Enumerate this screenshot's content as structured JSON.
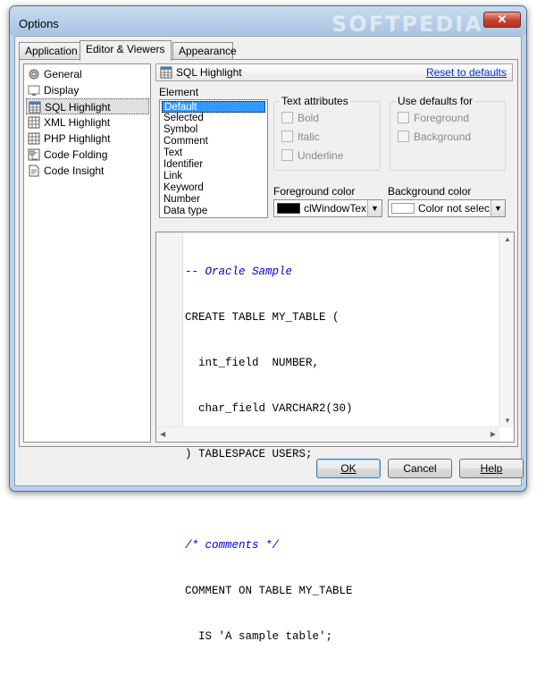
{
  "window": {
    "title": "Options",
    "watermark": "SOFTPEDIA",
    "close_glyph": "✕"
  },
  "tabs": [
    {
      "label": "Application",
      "active": false
    },
    {
      "label": "Editor & Viewers",
      "active": true
    },
    {
      "label": "Appearance",
      "active": false
    }
  ],
  "tree": {
    "items": [
      {
        "label": "General",
        "icon": "gear-icon"
      },
      {
        "label": "Display",
        "icon": "display-icon"
      },
      {
        "label": "SQL Highlight",
        "icon": "grid-icon",
        "selected": true
      },
      {
        "label": "XML Highlight",
        "icon": "grid-icon"
      },
      {
        "label": "PHP Highlight",
        "icon": "grid-icon"
      },
      {
        "label": "Code Folding",
        "icon": "folding-icon"
      },
      {
        "label": "Code Insight",
        "icon": "insight-icon"
      }
    ]
  },
  "panel": {
    "title": "SQL Highlight",
    "reset_label": "Reset to defaults",
    "element_label": "Element",
    "elements": [
      "Default",
      "Selected",
      "Symbol",
      "Comment",
      "Text",
      "Identifier",
      "Link",
      "Keyword",
      "Number",
      "Data type"
    ],
    "selected_element": "Default",
    "text_attributes": {
      "title": "Text attributes",
      "bold": "Bold",
      "italic": "Italic",
      "underline": "Underline"
    },
    "use_defaults": {
      "title": "Use defaults for",
      "foreground": "Foreground",
      "background": "Background"
    },
    "foreground": {
      "label": "Foreground color",
      "value": "clWindowText",
      "swatch": "#000000"
    },
    "background": {
      "label": "Background color",
      "value": "Color not selected",
      "swatch": "#ffffff"
    }
  },
  "code_lines": [
    {
      "text": "-- Oracle Sample",
      "comment": true
    },
    {
      "text": "CREATE TABLE MY_TABLE (",
      "comment": false
    },
    {
      "text": "  int_field  NUMBER,",
      "comment": false
    },
    {
      "text": "  char_field VARCHAR2(30)",
      "comment": false
    },
    {
      "text": ") TABLESPACE USERS;",
      "comment": false
    },
    {
      "text": "",
      "comment": false
    },
    {
      "text": "/* comments */",
      "comment": true
    },
    {
      "text": "COMMENT ON TABLE MY_TABLE",
      "comment": false
    },
    {
      "text": "  IS 'A sample table';",
      "comment": false
    }
  ],
  "buttons": {
    "ok": "OK",
    "cancel": "Cancel",
    "help": "Help"
  },
  "colors": {
    "selection": "#3399ff",
    "comment": "#0000cc",
    "link": "#0033cc"
  }
}
